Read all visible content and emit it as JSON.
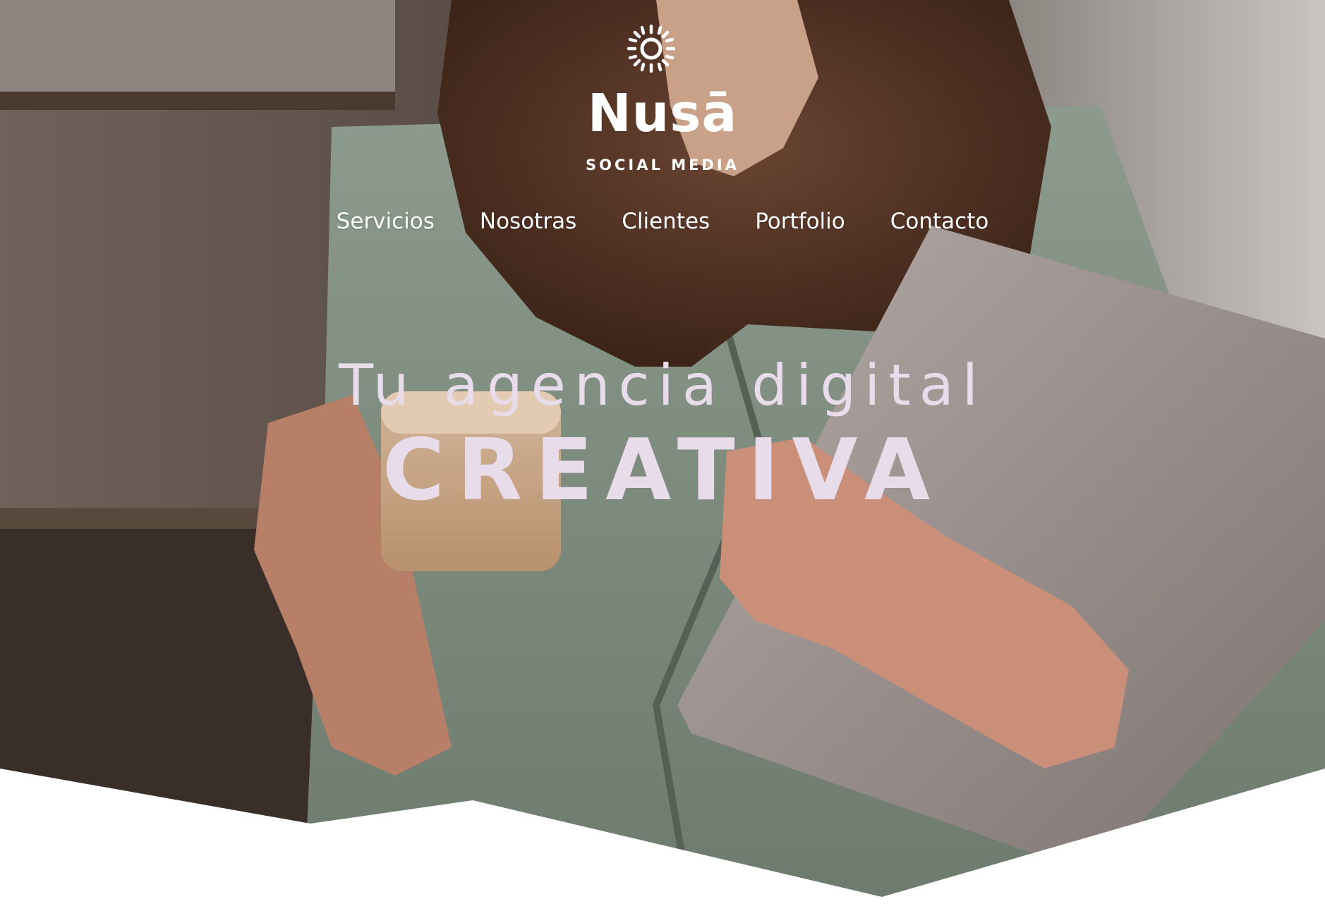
{
  "brand": {
    "name": "Nusā",
    "tagline": "SOCIAL MEDIA",
    "logo_icon": "sun-icon"
  },
  "nav": {
    "items": [
      {
        "label": "Servicios"
      },
      {
        "label": "Nosotras"
      },
      {
        "label": "Clientes"
      },
      {
        "label": "Portfolio"
      },
      {
        "label": "Contacto"
      }
    ]
  },
  "hero": {
    "headline": "Tu agencia digital",
    "headline_emphasis": "CREATIVA",
    "text_color": "#e8dcea"
  }
}
